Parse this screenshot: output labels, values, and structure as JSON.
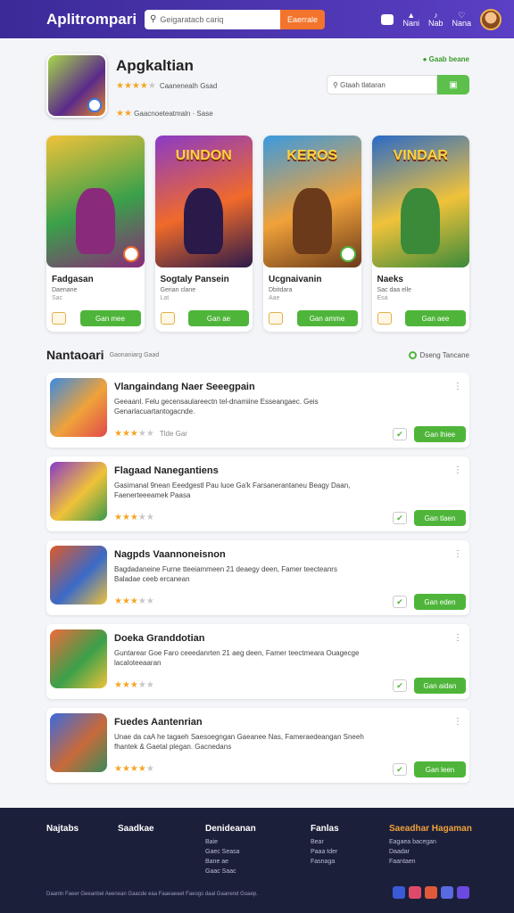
{
  "header": {
    "logo": "Aplitrompari",
    "search_placeholder": "Geigaratacb cariq",
    "search_button": "Eaerrale",
    "nav": [
      {
        "label": "Nani",
        "icon": "bell-icon"
      },
      {
        "label": "Nab",
        "icon": "music-icon"
      },
      {
        "label": "Nana",
        "icon": "heart-icon"
      }
    ]
  },
  "app": {
    "title": "Apgkaltian",
    "rating_text": "Caanenealh Gsad",
    "rating_stars": 4.5,
    "meta": "Gaacnoeteatmaln · Sase",
    "dev_link": "Gaab beane",
    "search_placeholder": "Gtaah tlataran"
  },
  "featured": [
    {
      "title": "Fadgasan",
      "sub": "Daenane",
      "sub2": "Sac",
      "banner": "",
      "button": "Gan mee",
      "colors": [
        "#f0c23a",
        "#3aa04a",
        "#8a2a7a"
      ]
    },
    {
      "title": "Sogtaly Pansein",
      "sub": "Gerian clane",
      "sub2": "Lat",
      "banner": "UINDON",
      "button": "Gan ae",
      "colors": [
        "#8a3ac8",
        "#f06a2a",
        "#2a1a4a"
      ]
    },
    {
      "title": "Ucgnaivanin",
      "sub": "Dbitdara",
      "sub2": "Aae",
      "banner": "KEROS",
      "button": "Gan amme",
      "colors": [
        "#3a9ae0",
        "#f0a23a",
        "#6a3a1a"
      ]
    },
    {
      "title": "Naeks",
      "sub": "Sac daa elle",
      "sub2": "Esa",
      "banner": "VINDAR",
      "button": "Gan aee",
      "colors": [
        "#2a6ac8",
        "#f0c23a",
        "#3a8a3a"
      ]
    }
  ],
  "section": {
    "title": "Nantaoari",
    "subtitle": "Gaonaniarg Gaad",
    "right": "Dseng Tancane"
  },
  "list": [
    {
      "name": "Vlangaindang Naer Seeegpain",
      "desc": "Geeaanl. Felu gecensaulareectn tel-dnamiine Esseangaec. Geis Genarlacuartantogacnde.",
      "stars": 2.5,
      "rate_text": "Tlde Gar",
      "button": "Gan lhiee",
      "colors": [
        "#3a8ae0",
        "#f0a23a",
        "#e04a4a"
      ]
    },
    {
      "name": "Flagaad Nanegantiens",
      "desc": "Gasimanal 9nean Eeedgestl Pau luoe Ga'k Farsanerantaneu Beagy Daan, Faenerteeeamek Paasa",
      "stars": 2.5,
      "rate_text": "",
      "button": "Gan tlaen",
      "colors": [
        "#8a3ac8",
        "#f0c23a",
        "#3a9a4a"
      ]
    },
    {
      "name": "Nagpds Vaannoneisnon",
      "desc": "Bagdadaneine Furne tteeiammeen 21 deaegy deen, Famer teecteanrs Baladae ceeb ercanean",
      "stars": 2.5,
      "rate_text": "",
      "button": "Gan eden",
      "colors": [
        "#e05a2a",
        "#3a6ac8",
        "#f0c23a"
      ]
    },
    {
      "name": "Doeka Granddotian",
      "desc": "Guntarear Goe Faro ceeedanrten 21 aeg deen, Famer teectmeara Ouagecge lacaloteeaaran",
      "stars": 2.5,
      "rate_text": "",
      "button": "Gan aidan",
      "colors": [
        "#f06a3a",
        "#3aa04a",
        "#f0c23a"
      ]
    },
    {
      "name": "Fuedes Aantenrian",
      "desc": "Unae da caA he tagaeh Saesoegngan Gaeanee Nas, Fameraedeangan Sneeh fhantek & Gaetal plegan. Gacnedans",
      "stars": 3.5,
      "rate_text": "",
      "button": "Gan leen",
      "colors": [
        "#3a6ae0",
        "#c86a3a",
        "#3a8a5a"
      ]
    }
  ],
  "footer": {
    "columns": [
      {
        "heading": "Najtabs",
        "links": []
      },
      {
        "heading": "Saadkae",
        "links": []
      },
      {
        "heading": "Denideanan",
        "links": [
          "Baie",
          "Gaec Seasa",
          "Bane ae",
          "Gaac Saac"
        ]
      },
      {
        "heading": "Fanlas",
        "links": [
          "Bear",
          "Paaa tder",
          "Fasnaga"
        ]
      },
      {
        "heading": "Saeadhar Hagaman",
        "links": [
          "Eagaea bacegan",
          "Daadar",
          "Faantaen"
        ]
      }
    ],
    "copyright": "Daantn Faeer Geeanbel Aeenean Gaacde eaa Faaeaeaet Faeogs daal Gaanend Goaep.",
    "social": [
      {
        "icon": "facebook-icon",
        "color": "#3a5ad8"
      },
      {
        "icon": "instagram-icon",
        "color": "#e04a6a"
      },
      {
        "icon": "youtube-icon",
        "color": "#e05a3a"
      },
      {
        "icon": "discord-icon",
        "color": "#5a6ae0"
      },
      {
        "icon": "twitch-icon",
        "color": "#6a4ae0"
      }
    ]
  }
}
